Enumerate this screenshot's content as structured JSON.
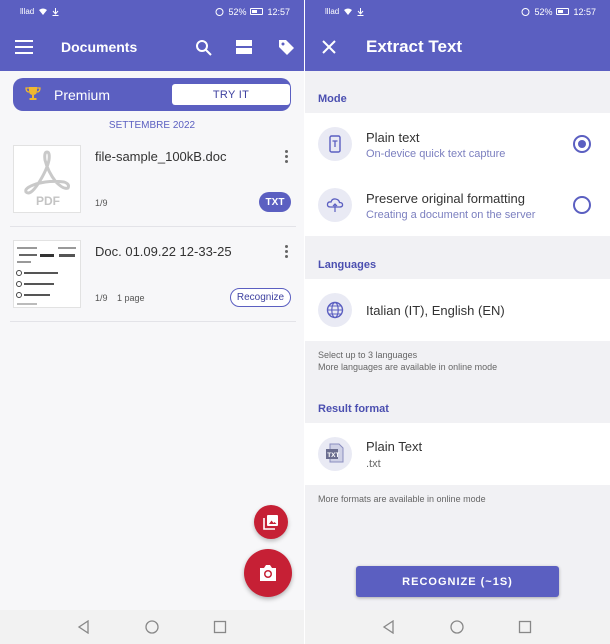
{
  "left": {
    "status": {
      "carrier": "lllad",
      "battery": "52%",
      "time": "12:57"
    },
    "appbar": {
      "title": "Documents"
    },
    "premium": {
      "label": "Premium",
      "cta": "TRY IT"
    },
    "date_header": "SETTEMBRE 2022",
    "documents": [
      {
        "name": "file-sample_100kB.doc",
        "pages": "1/9",
        "extra": "",
        "badge": "TXT",
        "thumb_label": "PDF"
      },
      {
        "name": "Doc. 01.09.22 12-33-25",
        "pages": "1/9",
        "extra": "1 page",
        "action": "Recognize"
      }
    ]
  },
  "right": {
    "status": {
      "carrier": "lllad",
      "battery": "52%",
      "time": "12:57"
    },
    "appbar": {
      "title": "Extract Text"
    },
    "mode": {
      "label": "Mode",
      "options": [
        {
          "title": "Plain text",
          "subtitle": "On-device quick text capture",
          "selected": true
        },
        {
          "title": "Preserve original formatting",
          "subtitle": "Creating a document on the server",
          "selected": false
        }
      ]
    },
    "languages": {
      "label": "Languages",
      "value": "Italian (IT), English (EN)",
      "hint_line1": "Select up to 3 languages",
      "hint_line2": "More languages are available in online mode"
    },
    "result_format": {
      "label": "Result format",
      "title": "Plain Text",
      "ext": ".txt",
      "hint": "More formats are available in online mode"
    },
    "recognize_button": "RECOGNIZE (~1S)"
  },
  "colors": {
    "primary": "#5b5fc1",
    "fab": "#c62035",
    "subtle": "#7b7fbf"
  }
}
